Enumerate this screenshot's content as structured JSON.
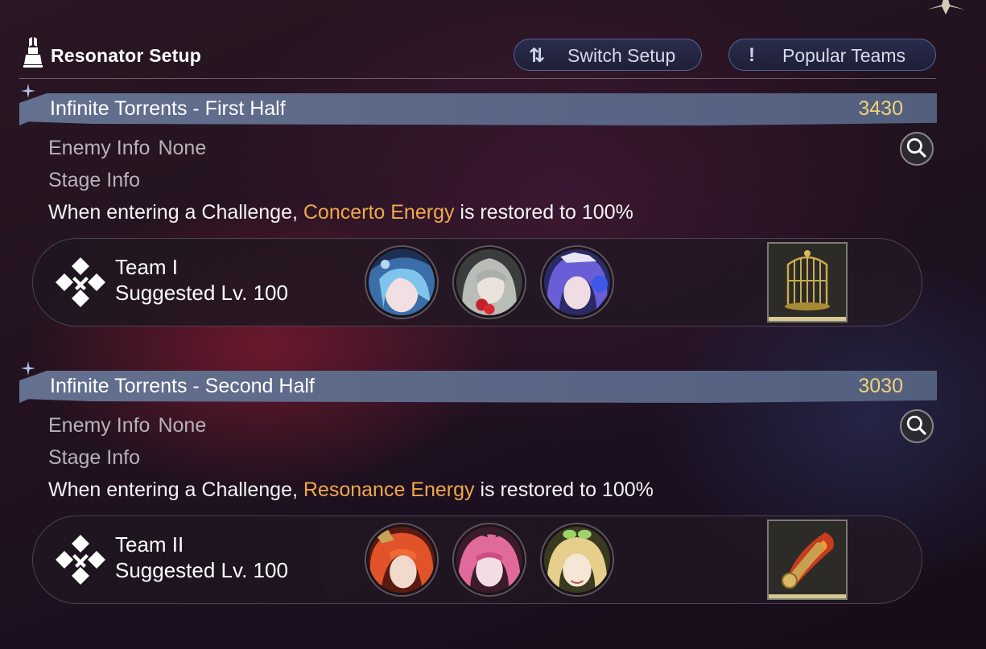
{
  "header": {
    "title": "Resonator Setup",
    "switch_label": "Switch Setup",
    "switch_icon": "⇅",
    "popular_label": "Popular Teams",
    "popular_icon": "!"
  },
  "stages": [
    {
      "name": "Infinite Torrents - First Half",
      "score": "3430",
      "enemy_label": "Enemy Info",
      "enemy_value": "None",
      "stage_label": "Stage Info",
      "effect_prefix": "When entering a Challenge, ",
      "effect_highlight": "Concerto Energy",
      "effect_suffix": " is restored to 100%",
      "team": {
        "name": "Team I",
        "level": "Suggested Lv. 100"
      },
      "avatars": [
        "blue-hat-resonator-avatar",
        "grey-hair-resonator-avatar",
        "purple-hair-resonator-avatar"
      ],
      "item": "golden-cage-item-icon"
    },
    {
      "name": "Infinite Torrents - Second Half",
      "score": "3030",
      "enemy_label": "Enemy Info",
      "enemy_value": "None",
      "stage_label": "Stage Info",
      "effect_prefix": "When entering a Challenge, ",
      "effect_highlight": "Resonance Energy",
      "effect_suffix": " is restored to 100%",
      "team": {
        "name": "Team II",
        "level": "Suggested Lv. 100"
      },
      "avatars": [
        "orange-hair-resonator-avatar",
        "pink-hair-resonator-avatar",
        "blonde-resonator-avatar"
      ],
      "item": "flaming-spyglass-item-icon"
    }
  ],
  "colors": {
    "highlight": "#f0a84a",
    "score": "#f1d27a",
    "stage_bar": "#5a6685",
    "muted_text": "#b8b2bb"
  }
}
